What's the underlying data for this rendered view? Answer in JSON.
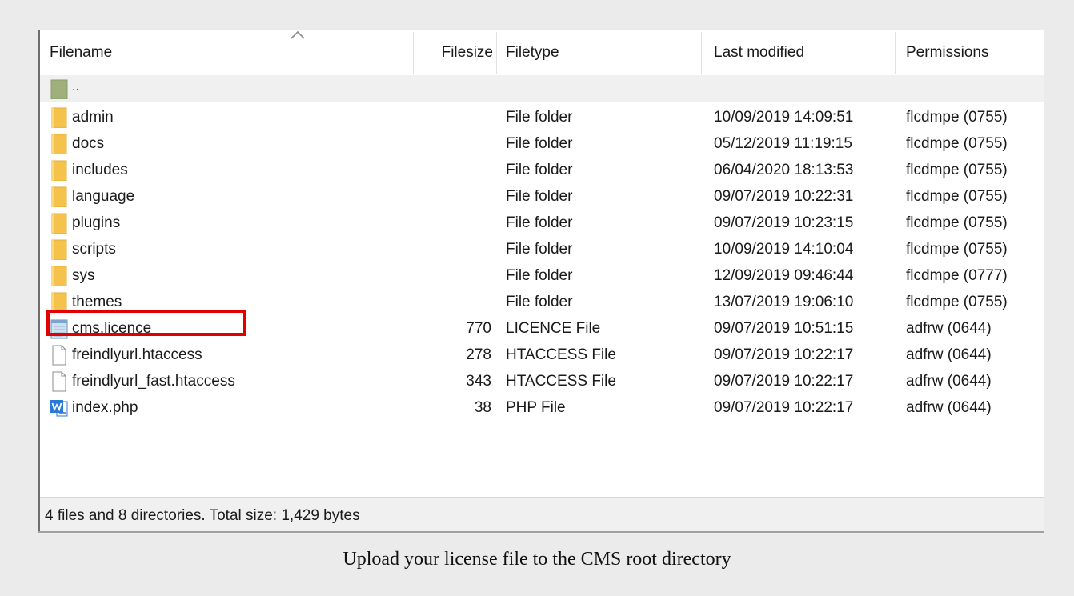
{
  "columns": {
    "filename": "Filename",
    "filesize": "Filesize",
    "filetype": "Filetype",
    "last_modified": "Last modified",
    "permissions": "Permissions"
  },
  "parent": {
    "name": "..",
    "icon": "parent-folder-icon"
  },
  "files": [
    {
      "name": "admin",
      "size": "",
      "type": "File folder",
      "modified": "10/09/2019 14:09:51",
      "perms": "flcdmpe (0755)",
      "icon": "folder-icon"
    },
    {
      "name": "docs",
      "size": "",
      "type": "File folder",
      "modified": "05/12/2019 11:19:15",
      "perms": "flcdmpe (0755)",
      "icon": "folder-icon"
    },
    {
      "name": "includes",
      "size": "",
      "type": "File folder",
      "modified": "06/04/2020 18:13:53",
      "perms": "flcdmpe (0755)",
      "icon": "folder-icon"
    },
    {
      "name": "language",
      "size": "",
      "type": "File folder",
      "modified": "09/07/2019 10:22:31",
      "perms": "flcdmpe (0755)",
      "icon": "folder-icon"
    },
    {
      "name": "plugins",
      "size": "",
      "type": "File folder",
      "modified": "09/07/2019 10:23:15",
      "perms": "flcdmpe (0755)",
      "icon": "folder-icon"
    },
    {
      "name": "scripts",
      "size": "",
      "type": "File folder",
      "modified": "10/09/2019 14:10:04",
      "perms": "flcdmpe (0755)",
      "icon": "folder-icon"
    },
    {
      "name": "sys",
      "size": "",
      "type": "File folder",
      "modified": "12/09/2019 09:46:44",
      "perms": "flcdmpe (0777)",
      "icon": "folder-icon"
    },
    {
      "name": "themes",
      "size": "",
      "type": "File folder",
      "modified": "13/07/2019 19:06:10",
      "perms": "flcdmpe (0755)",
      "icon": "folder-icon"
    },
    {
      "name": "cms.licence",
      "size": "770",
      "type": "LICENCE File",
      "modified": "09/07/2019 10:51:15",
      "perms": "adfrw (0644)",
      "icon": "text-file-icon"
    },
    {
      "name": "freindlyurl.htaccess",
      "size": "278",
      "type": "HTACCESS File",
      "modified": "09/07/2019 10:22:17",
      "perms": "adfrw (0644)",
      "icon": "blank-file-icon"
    },
    {
      "name": "freindlyurl_fast.htaccess",
      "size": "343",
      "type": "HTACCESS File",
      "modified": "09/07/2019 10:22:17",
      "perms": "adfrw (0644)",
      "icon": "blank-file-icon"
    },
    {
      "name": "index.php",
      "size": "38",
      "type": "PHP File",
      "modified": "09/07/2019 10:22:17",
      "perms": "adfrw (0644)",
      "icon": "word-file-icon"
    }
  ],
  "status": "4 files and 8 directories. Total size: 1,429 bytes",
  "caption": "Upload your license file to the CMS root directory",
  "colors": {
    "folder": "#f5c24c",
    "highlight": "#e00000",
    "word_blue": "#2b79d6",
    "parent_green": "#9fb07d"
  }
}
